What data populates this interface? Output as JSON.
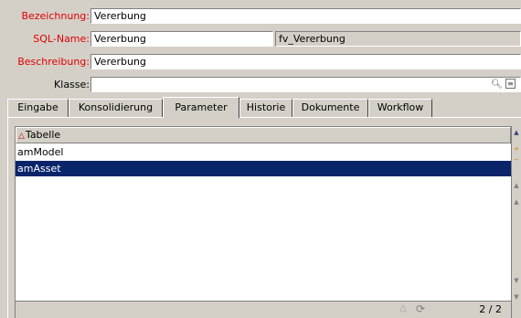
{
  "fields": {
    "bezeichnung": {
      "label": "Bezeichnung:",
      "value": "Vererbung"
    },
    "sqlname": {
      "label": "SQL-Name:",
      "value": "Vererbung",
      "table_value": "fv_Vererbung"
    },
    "beschreibung": {
      "label": "Beschreibung:",
      "value": "Vererbung"
    },
    "klasse": {
      "label": "Klasse:",
      "value": ""
    }
  },
  "tabs": [
    {
      "label": "Eingabe"
    },
    {
      "label": "Konsolidierung"
    },
    {
      "label": "Parameter",
      "active": true
    },
    {
      "label": "Historie"
    },
    {
      "label": "Dokumente"
    },
    {
      "label": "Workflow"
    }
  ],
  "list": {
    "column": "Tabelle",
    "rows": [
      "amModel",
      "amAsset"
    ],
    "selected_index": 1,
    "page": "2 / 2"
  },
  "icons": {
    "sort": "sort-ascending-icon",
    "search": "search-icon",
    "details": "details-icon",
    "warning": "warning-icon",
    "refresh": "refresh-icon"
  },
  "colors": {
    "required_label": "#e00000",
    "selection": "#0a246a",
    "chrome": "#d4d0c8"
  }
}
